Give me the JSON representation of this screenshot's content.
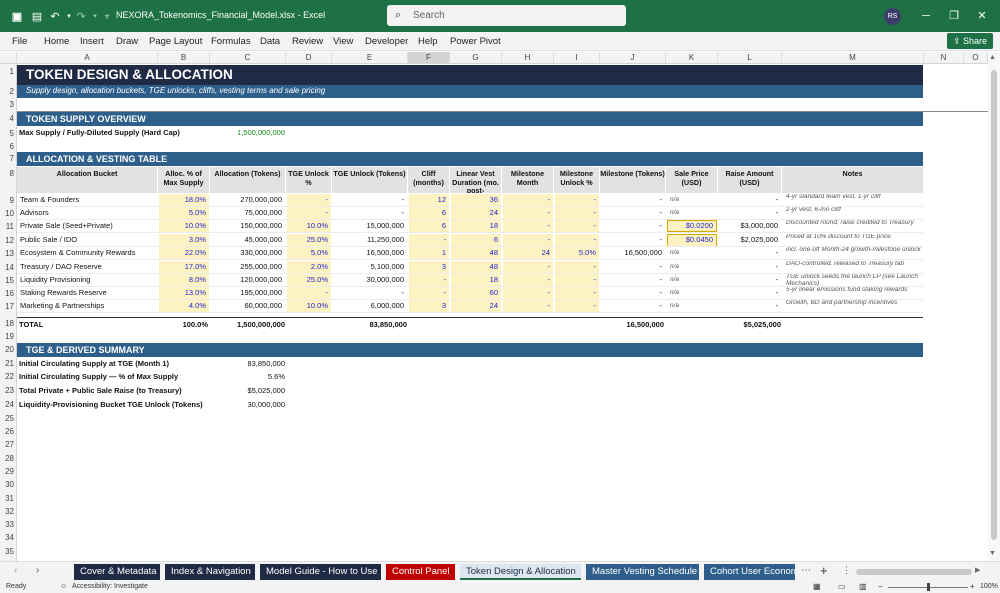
{
  "window": {
    "doc_title": "NEXORA_Tokenomics_Financial_Model.xlsx  -  Excel",
    "search_placeholder": "Search",
    "avatar_initials": "RS",
    "share_label": "Share"
  },
  "menu": [
    "File",
    "Home",
    "Insert",
    "Draw",
    "Page Layout",
    "Formulas",
    "Data",
    "Review",
    "View",
    "Developer",
    "Help",
    "Power Pivot"
  ],
  "columns": [
    "A",
    "B",
    "C",
    "D",
    "E",
    "F",
    "G",
    "H",
    "I",
    "J",
    "K",
    "L",
    "M",
    "N",
    "O"
  ],
  "rows": [
    "1",
    "2",
    "3",
    "4",
    "5",
    "6",
    "7",
    "8",
    "9",
    "10",
    "11",
    "12",
    "13",
    "14",
    "15",
    "16",
    "17",
    "18",
    "19",
    "20",
    "21",
    "22",
    "23",
    "24",
    "25",
    "26",
    "27",
    "28",
    "29",
    "30",
    "31",
    "32",
    "33",
    "34",
    "35",
    "36"
  ],
  "sheet": {
    "title": "TOKEN DESIGN & ALLOCATION",
    "subtitle": "Supply design, allocation buckets, TGE unlocks, cliffs, vesting terms and sale pricing",
    "sec_supply": "TOKEN SUPPLY OVERVIEW",
    "max_supply_label": "Max Supply / Fully-Diluted Supply (Hard Cap)",
    "max_supply_value": "1,500,000,000",
    "sec_alloc": "ALLOCATION & VESTING TABLE",
    "headers": [
      "Allocation Bucket",
      "Alloc. % of Max Supply",
      "Allocation (Tokens)",
      "TGE Unlock %",
      "TGE Unlock (Tokens)",
      "Cliff (months)",
      "Linear Vest Duration (mo. post-",
      "Milestone Month",
      "Milestone Unlock %",
      "Milestone (Tokens)",
      "Sale Price (USD)",
      "Raise Amount (USD)",
      "Notes"
    ],
    "alloc_rows": [
      {
        "name": "Team & Founders",
        "pct": "18.0%",
        "tokens": "270,000,000",
        "tge_pct": "-",
        "tge_tok": "-",
        "cliff": "12",
        "vest": "36",
        "mm": "-",
        "mu": "-",
        "mtok": "-",
        "price": "n/a",
        "raise": "-",
        "note": "4-yr standard team vest, 1-yr cliff"
      },
      {
        "name": "Advisors",
        "pct": "5.0%",
        "tokens": "75,000,000",
        "tge_pct": "-",
        "tge_tok": "-",
        "cliff": "6",
        "vest": "24",
        "mm": "-",
        "mu": "-",
        "mtok": "-",
        "price": "n/a",
        "raise": "-",
        "note": "2-yr vest, 6-mo cliff"
      },
      {
        "name": "Private Sale (Seed+Private)",
        "pct": "10.0%",
        "tokens": "150,000,000",
        "tge_pct": "10.0%",
        "tge_tok": "15,000,000",
        "cliff": "6",
        "vest": "18",
        "mm": "-",
        "mu": "-",
        "mtok": "-",
        "price": "$0.0200",
        "raise": "$3,000,000",
        "note": "Discounted round; raise credited to Treasury"
      },
      {
        "name": "Public Sale / IDO",
        "pct": "3.0%",
        "tokens": "45,000,000",
        "tge_pct": "25.0%",
        "tge_tok": "11,250,000",
        "cliff": "-",
        "vest": "6",
        "mm": "-",
        "mu": "-",
        "mtok": "-",
        "price": "$0.0450",
        "raise": "$2,025,000",
        "note": "Priced at 10% discount to TGE price"
      },
      {
        "name": "Ecosystem & Community Rewards",
        "pct": "22.0%",
        "tokens": "330,000,000",
        "tge_pct": "5.0%",
        "tge_tok": "16,500,000",
        "cliff": "1",
        "vest": "48",
        "mm": "24",
        "mu": "5.0%",
        "mtok": "16,500,000",
        "price": "n/a",
        "raise": "-",
        "note": "incl. one-off Month-24 growth-milestone unlock"
      },
      {
        "name": "Treasury / DAO Reserve",
        "pct": "17.0%",
        "tokens": "255,000,000",
        "tge_pct": "2.0%",
        "tge_tok": "5,100,000",
        "cliff": "3",
        "vest": "48",
        "mm": "-",
        "mu": "-",
        "mtok": "-",
        "price": "n/a",
        "raise": "-",
        "note": "DAO-controlled, released to Treasury tab"
      },
      {
        "name": "Liquidity Provisioning",
        "pct": "8.0%",
        "tokens": "120,000,000",
        "tge_pct": "25.0%",
        "tge_tok": "30,000,000",
        "cliff": "-",
        "vest": "18",
        "mm": "-",
        "mu": "-",
        "mtok": "-",
        "price": "n/a",
        "raise": "-",
        "note": "TGE unlock seeds the launch LP (see Launch Mechanics)"
      },
      {
        "name": "Staking Rewards Reserve",
        "pct": "13.0%",
        "tokens": "195,000,000",
        "tge_pct": "-",
        "tge_tok": "-",
        "cliff": "-",
        "vest": "60",
        "mm": "-",
        "mu": "-",
        "mtok": "-",
        "price": "n/a",
        "raise": "-",
        "note": "5-yr linear emissions fund staking rewards"
      },
      {
        "name": "Marketing & Partnerships",
        "pct": "4.0%",
        "tokens": "60,000,000",
        "tge_pct": "10.0%",
        "tge_tok": "6,000,000",
        "cliff": "3",
        "vest": "24",
        "mm": "-",
        "mu": "-",
        "mtok": "-",
        "price": "n/a",
        "raise": "-",
        "note": "Growth, BD and partnership incentives"
      }
    ],
    "total": {
      "label": "TOTAL",
      "pct": "100.0%",
      "tokens": "1,500,000,000",
      "tge_tok": "83,850,000",
      "mtok": "16,500,000",
      "raise": "$5,025,000"
    },
    "sec_tge": "TGE & DERIVED SUMMARY",
    "tge_rows": [
      {
        "label": "Initial Circulating Supply at TGE (Month 1)",
        "value": "83,850,000"
      },
      {
        "label": "Initial Circulating Supply — % of Max Supply",
        "value": "5.6%"
      },
      {
        "label": "Total Private + Public Sale Raise (to Treasury)",
        "value": "$5,025,000"
      },
      {
        "label": "Liquidity-Provisioning Bucket TGE Unlock (Tokens)",
        "value": "30,000,000"
      }
    ]
  },
  "tabs": [
    {
      "label": "Cover & Metadata",
      "color": "#1f2a44"
    },
    {
      "label": "Index & Navigation",
      "color": "#1f2a44"
    },
    {
      "label": "Model Guide - How to Use",
      "color": "#1f2a44"
    },
    {
      "label": "Control Panel",
      "color": "#c00000"
    },
    {
      "label": "Token Design & Allocation",
      "color": "#dce6f1"
    },
    {
      "label": "Master Vesting Schedule",
      "color": "#2e5f8a"
    },
    {
      "label": "Cohort User Economi",
      "color": "#2e5f8a"
    }
  ],
  "status": {
    "ready": "Ready",
    "accessibility": "Accessibility: Investigate",
    "zoom": "100%"
  },
  "colors": {
    "excel_green": "#1e7145",
    "title_navy": "#1f2a44",
    "section_blue": "#2e5f8a",
    "input_fill": "#fdf3c2"
  }
}
